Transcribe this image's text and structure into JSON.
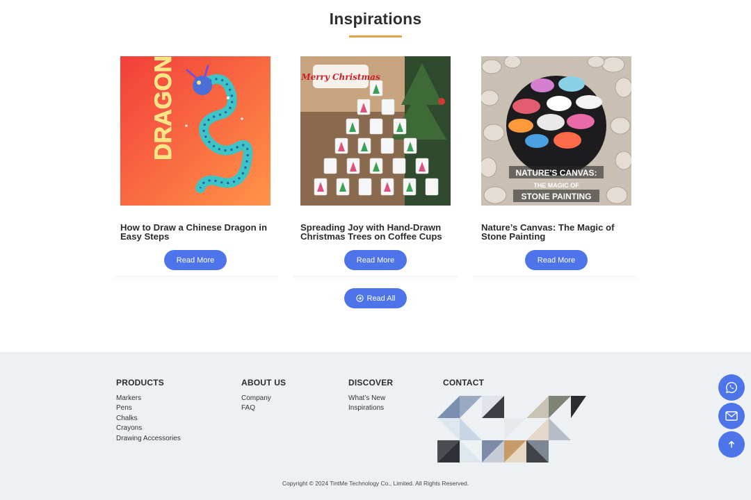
{
  "section": {
    "title": "Inspirations"
  },
  "cards": [
    {
      "title": "How to Draw a Chinese Dragon in Easy Steps",
      "image_text": "DRAGON",
      "button": "Read More"
    },
    {
      "title": "Spreading Joy with Hand-Drawn Christmas Trees on Coffee Cups",
      "image_text": "Merry Christmas",
      "button": "Read More"
    },
    {
      "title": "Nature’s Canvas: The Magic of Stone Painting",
      "image_text_1": "NATURE'S CANVAS:",
      "image_text_2": "THE MAGIC OF",
      "image_text_3": "STONE PAINTING",
      "button": "Read More"
    }
  ],
  "read_all": {
    "label": "Read All",
    "icon": "arrow-circle-right-icon"
  },
  "footer": {
    "products": {
      "heading": "PRODUCTS",
      "links": [
        "Markers",
        "Pens",
        "Chalks",
        "Crayons",
        "Drawing Accessories"
      ]
    },
    "about": {
      "heading": "ABOUT US",
      "links": [
        "Company",
        "FAQ"
      ]
    },
    "discover": {
      "heading": "DISCOVER",
      "links": [
        "What’s New",
        "Inspirations"
      ]
    },
    "contact": {
      "heading": "CONTACT"
    },
    "copyright": "Copyright © 2024 TintMe Technology Co., Limited. All Rights Reserved."
  },
  "floating": {
    "icons": [
      "whatsapp-icon",
      "mail-icon",
      "arrow-up-icon"
    ]
  },
  "colors": {
    "accent": "#4e74ea",
    "underline": "#e0a24a",
    "footer_bg": "#eef1f4"
  }
}
